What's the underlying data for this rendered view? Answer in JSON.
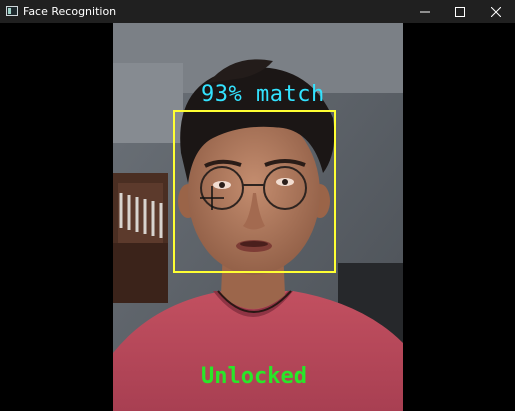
{
  "window": {
    "title": "Face Recognition",
    "icon": "app-window-icon",
    "controls": {
      "minimize": "minimize-icon",
      "maximize": "maximize-icon",
      "close": "close-icon"
    }
  },
  "overlay": {
    "match_text": "93% match",
    "status_text": "Unlocked",
    "colors": {
      "match_text": "#33e3ff",
      "face_box": "#ffff33",
      "status_text": "#29e629",
      "cursor": "#000000"
    }
  }
}
